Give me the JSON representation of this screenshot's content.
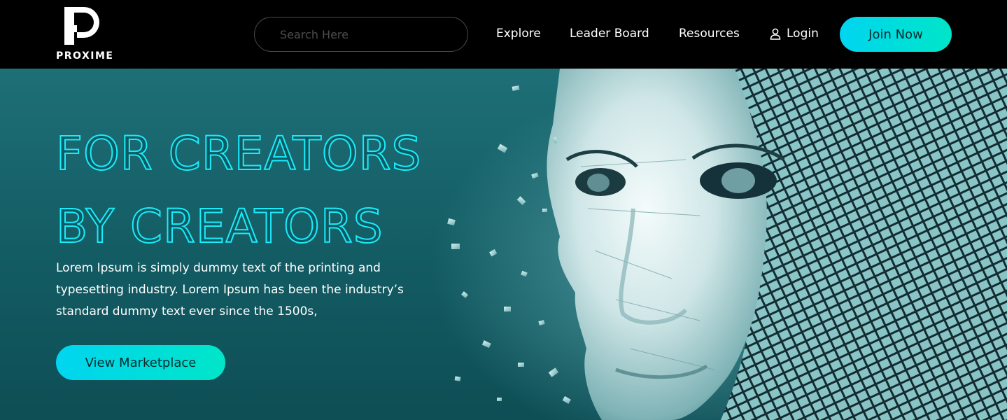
{
  "brand": {
    "name": "PROXIME",
    "logo_icon": "p-logo-icon"
  },
  "search": {
    "placeholder": "Search Here",
    "value": ""
  },
  "nav": {
    "explore": "Explore",
    "leader_board": "Leader Board",
    "resources": "Resources",
    "login": "Login",
    "login_icon": "user-icon"
  },
  "header": {
    "join_label": "Join Now"
  },
  "hero": {
    "title_line1": "FOR CREATORS",
    "title_line2": "BY CREATORS",
    "description": "Lorem Ipsum is simply dummy text of the printing and typesetting industry. Lorem Ipsum has been the industry’s standard dummy text ever since the 1500s,",
    "cta_label": "View Marketplace"
  },
  "colors": {
    "accent_start": "#00d5f0",
    "accent_end": "#00e5c8",
    "header_bg": "#000000",
    "hero_bg": "#1a6a72",
    "title_outline": "#18f0ff"
  }
}
